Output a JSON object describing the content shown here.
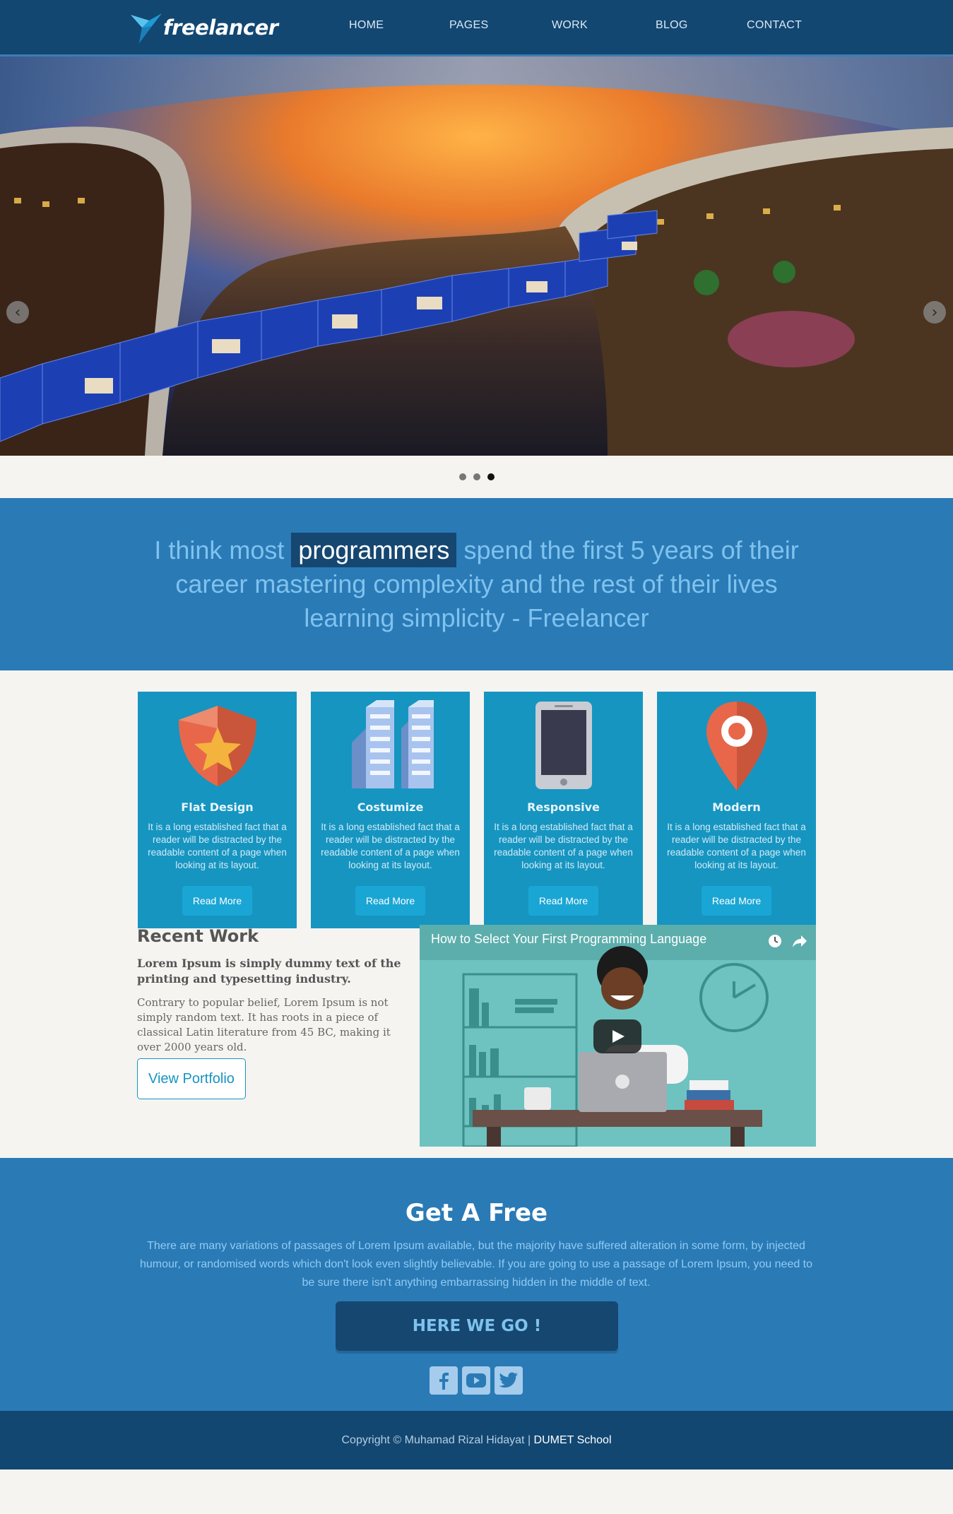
{
  "brand": {
    "name": "freelancer"
  },
  "nav": {
    "items": [
      "HOME",
      "PAGES",
      "WORK",
      "BLOG",
      "CONTACT"
    ]
  },
  "slider": {
    "prev_glyph": "‹",
    "next_glyph": "›",
    "dots": 3,
    "active_dot": 3
  },
  "quote": {
    "before": "I think most ",
    "highlight": "programmers",
    "after": " spend the first 5 years of their career mastering complexity and the rest of their lives learning simplicity - Freelancer"
  },
  "features": [
    {
      "title": "Flat Design",
      "text": "It is a long established fact that a reader will be distracted by the readable content of a page when looking at its layout.",
      "button": "Read More",
      "icon": "shield-star-icon"
    },
    {
      "title": "Costumize",
      "text": "It is a long established fact that a reader will be distracted by the readable content of a page when looking at its layout.",
      "button": "Read More",
      "icon": "buildings-icon"
    },
    {
      "title": "Responsive",
      "text": "It is a long established fact that a reader will be distracted by the readable content of a page when looking at its layout.",
      "button": "Read More",
      "icon": "tablet-icon"
    },
    {
      "title": "Modern",
      "text": "It is a long established fact that a reader will be distracted by the readable content of a page when looking at its layout.",
      "button": "Read More",
      "icon": "map-pin-icon"
    }
  ],
  "recent": {
    "title": "Recent Work",
    "lead": "Lorem Ipsum is simply dummy text of the printing and typesetting industry.",
    "body": "Contrary to popular belief, Lorem Ipsum is not simply random text. It has roots in a piece of classical Latin literature from 45 BC, making it over 2000 years old.",
    "button": "View Portfolio",
    "video_title": "How to Select Your First Programming Language"
  },
  "cta": {
    "title": "Get A Free",
    "text": "There are many variations of passages of Lorem Ipsum available, but the majority have suffered alteration in some form, by injected humour, or randomised words which don't look even slightly believable. If you are going to use a passage of Lorem Ipsum, you need to be sure there isn't anything embarrassing hidden in the middle of text.",
    "button": "HERE WE GO !",
    "social": [
      "facebook-icon",
      "youtube-icon",
      "twitter-icon"
    ]
  },
  "footer": {
    "copyright": "Copyright © Muhamad Rizal Hidayat | ",
    "school": "DUMET School"
  },
  "colors": {
    "header": "#124772",
    "accent": "#2a7ab6",
    "card": "#1695c1",
    "highlight": "#154771"
  }
}
